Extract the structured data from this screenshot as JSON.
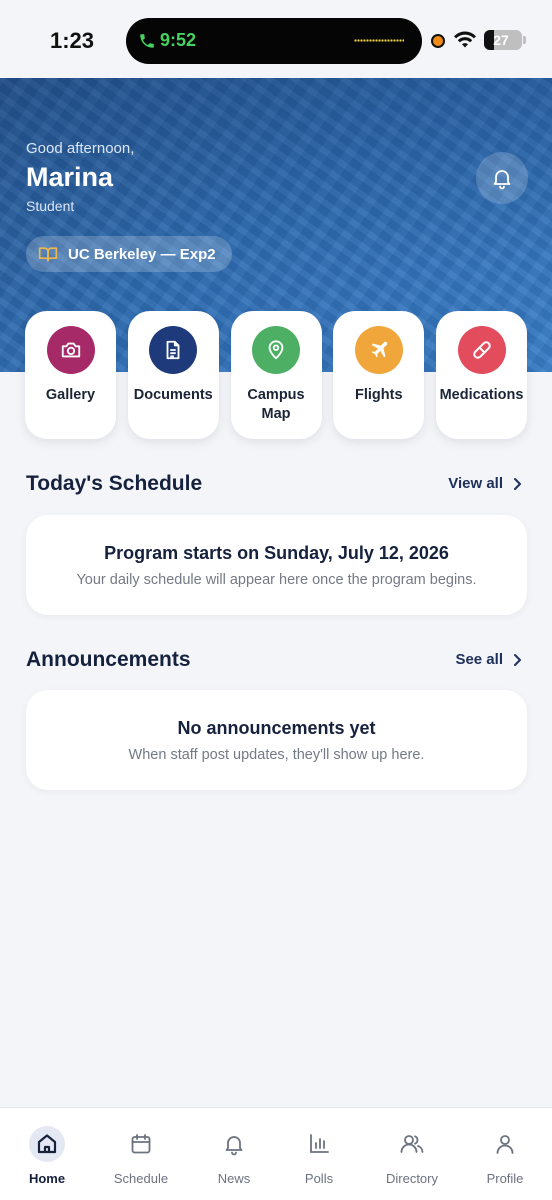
{
  "status_bar": {
    "time": "1:23",
    "call_time": "9:52",
    "battery_level": "27"
  },
  "header": {
    "greeting": "Good afternoon,",
    "name": "Marina",
    "role": "Student",
    "program": "UC Berkeley — Exp2",
    "notification_icon": "bell-icon"
  },
  "quick_actions": [
    {
      "label": "Gallery",
      "icon": "camera-icon",
      "color": "#a52a67"
    },
    {
      "label": "Documents",
      "icon": "document-icon",
      "color": "#1e3a7a"
    },
    {
      "label": "Campus Map",
      "icon": "map-pin-icon",
      "color": "#4caf63"
    },
    {
      "label": "Flights",
      "icon": "plane-icon",
      "color": "#f0a63a"
    },
    {
      "label": "Medications",
      "icon": "pill-icon",
      "color": "#e34c5c"
    }
  ],
  "schedule": {
    "title": "Today's Schedule",
    "link": "View all",
    "card_title": "Program starts on Sunday, July 12, 2026",
    "card_subtitle": "Your daily schedule will appear here once the program begins."
  },
  "announcements": {
    "title": "Announcements",
    "link": "See all",
    "card_title": "No announcements yet",
    "card_subtitle": "When staff post updates, they'll show up here."
  },
  "nav": {
    "items": [
      {
        "label": "Home",
        "icon": "home-icon",
        "active": true
      },
      {
        "label": "Schedule",
        "icon": "calendar-icon"
      },
      {
        "label": "News",
        "icon": "bell-icon"
      },
      {
        "label": "Polls",
        "icon": "bar-chart-icon"
      },
      {
        "label": "Directory",
        "icon": "users-icon"
      },
      {
        "label": "Profile",
        "icon": "user-icon"
      }
    ]
  },
  "colors": {
    "accent": "#16213e",
    "hero": "#2f6fb5",
    "background": "#f4f5f8"
  }
}
